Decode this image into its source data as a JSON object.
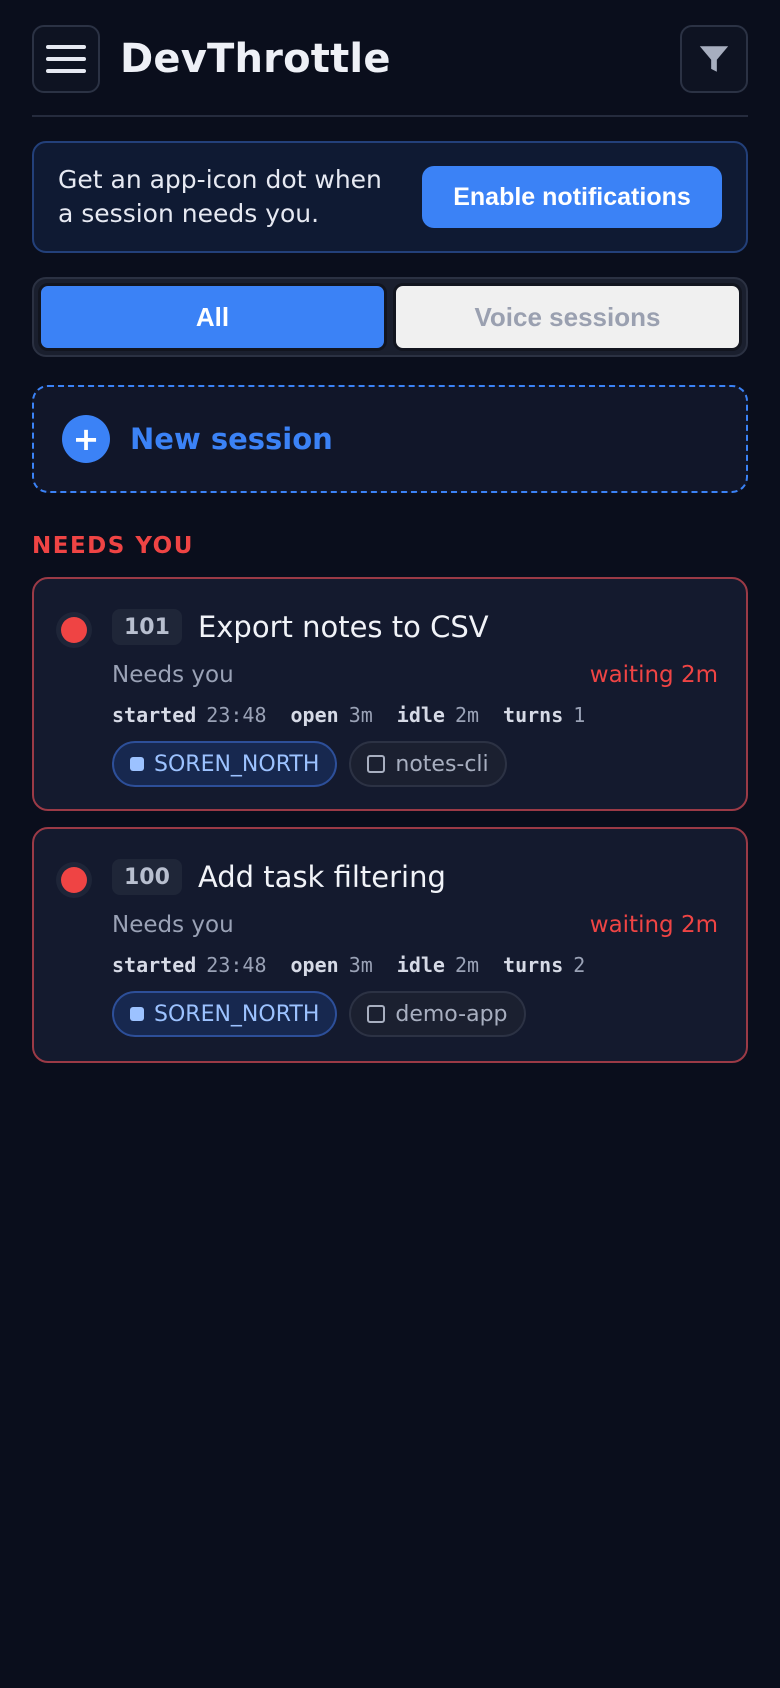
{
  "header": {
    "title": "DevThrottle"
  },
  "notification": {
    "text": "Get an app-icon dot when a session needs you.",
    "button_label": "Enable notifications"
  },
  "tabs": [
    {
      "label": "All",
      "active": true
    },
    {
      "label": "Voice sessions",
      "active": false
    }
  ],
  "new_session": {
    "icon": "+",
    "label": "New session"
  },
  "section": {
    "title": "NEEDS YOU"
  },
  "sessions": [
    {
      "number": "101",
      "title": "Export notes to CSV",
      "status": "Needs you",
      "waiting": "waiting 2m",
      "meta": {
        "started_label": "started",
        "started": "23:48",
        "open_label": "open",
        "open": "3m",
        "idle_label": "idle",
        "idle": "2m",
        "turns_label": "turns",
        "turns": "1"
      },
      "user": "SOREN_NORTH",
      "repo": "notes-cli"
    },
    {
      "number": "100",
      "title": "Add task filtering",
      "status": "Needs you",
      "waiting": "waiting 2m",
      "meta": {
        "started_label": "started",
        "started": "23:48",
        "open_label": "open",
        "open": "3m",
        "idle_label": "idle",
        "idle": "2m",
        "turns_label": "turns",
        "turns": "2"
      },
      "user": "SOREN_NORTH",
      "repo": "demo-app"
    }
  ],
  "colors": {
    "background": "#0a0e1c",
    "accent": "#3b82f6",
    "alert": "#ef4444"
  }
}
